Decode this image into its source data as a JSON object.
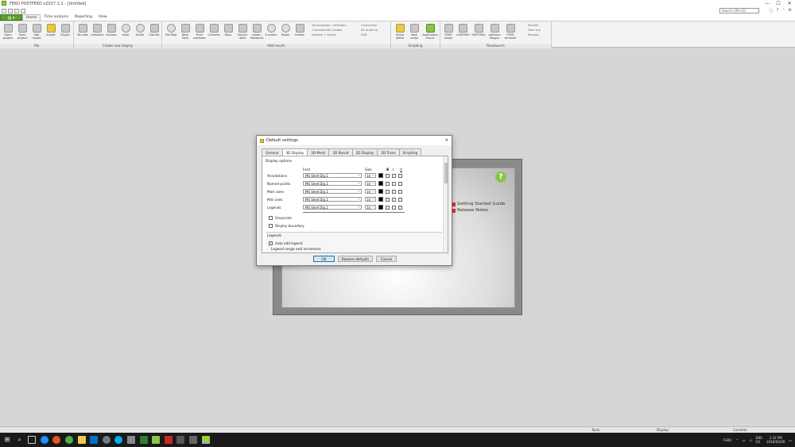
{
  "window": {
    "title": "FEKO POSTFEKO v2017.1.1 - [Untitled]",
    "controls": [
      "—",
      "☐",
      "✕"
    ]
  },
  "search": {
    "placeholder": "Search (Alt+Q)"
  },
  "ribbon_tabs": {
    "file": "",
    "items": [
      "Home",
      "Time analysis",
      "Reporting",
      "View"
    ]
  },
  "ribbon": {
    "groups": [
      {
        "label": "File",
        "buttons": [
          "Open project",
          "Save project",
          "Add model",
          "Import",
          "Export"
        ]
      },
      {
        "label": "Create new display",
        "buttons": [
          "3D view",
          "Cartesian",
          "Surface",
          "Polar",
          "Smith",
          "Slot file"
        ]
      },
      {
        "label": "Add results",
        "buttons": [
          "File field",
          "Near field",
          "Error estimate",
          "Currents",
          "Rays",
          "Source data",
          "Loads / Networks",
          "S-matrix",
          "Power",
          "Probes"
        ]
      },
      {
        "label": "Scripting",
        "buttons": [
          "Script editor",
          "New script",
          "Application macro"
        ]
      },
      {
        "label": "Run/launch",
        "buttons": [
          "FEKO solver",
          "CADFEKO",
          "EDITFEKO",
          "Antenna Magus",
          "FEKO terminal",
          "Remote"
        ]
      }
    ],
    "add_results_list": [
      "Transmission / reflection",
      "Characteristic modes",
      "Imports + scripts",
      "Connection",
      "RX antenna",
      "SAR"
    ],
    "runlaunch_list": [
      "Parallel",
      "Farm out",
      "Remote"
    ]
  },
  "start": {
    "help": "?",
    "links": [
      "Getting Started Guide",
      "Release Notes"
    ]
  },
  "dialog": {
    "title": "Default settings",
    "close": "✕",
    "tabs": [
      "General",
      "3D Display",
      "3D Mesh",
      "3D Result",
      "2D Display",
      "2D Trace",
      "Scripting"
    ],
    "active_tab": "3D Display",
    "section": "Display options",
    "col_font": "Font",
    "col_size": "Size",
    "col_b": "B",
    "col_i": "I",
    "col_u": "U",
    "rows": [
      {
        "label": "Annotations",
        "font": "MS Shell Dlg 2",
        "size": "10"
      },
      {
        "label": "Named points",
        "font": "MS Shell Dlg 2",
        "size": "10"
      },
      {
        "label": "Main axes",
        "font": "MS Shell Dlg 2",
        "size": "10"
      },
      {
        "label": "Mini axes",
        "font": "MS Shell Dlg 2",
        "size": "10"
      },
      {
        "label": "Legends",
        "font": "MS Shell Dlg 2",
        "size": "10"
      }
    ],
    "greyscale": "Greyscale",
    "display_boundary": "Display boundary",
    "legends_section": "Legends",
    "auto_add": "Auto add legend",
    "legend_range": "Legend range and increment",
    "buttons": {
      "ok": "OK",
      "restore": "Restore defaults",
      "cancel": "Cancel"
    }
  },
  "statusbar": {
    "tools": "Tools:",
    "display": "Display:",
    "currents": "Currents:"
  },
  "tray": {
    "app": "FEKO",
    "lang": "ENG\nUS",
    "time": "2:32 PM",
    "date": "2018/02/09"
  }
}
